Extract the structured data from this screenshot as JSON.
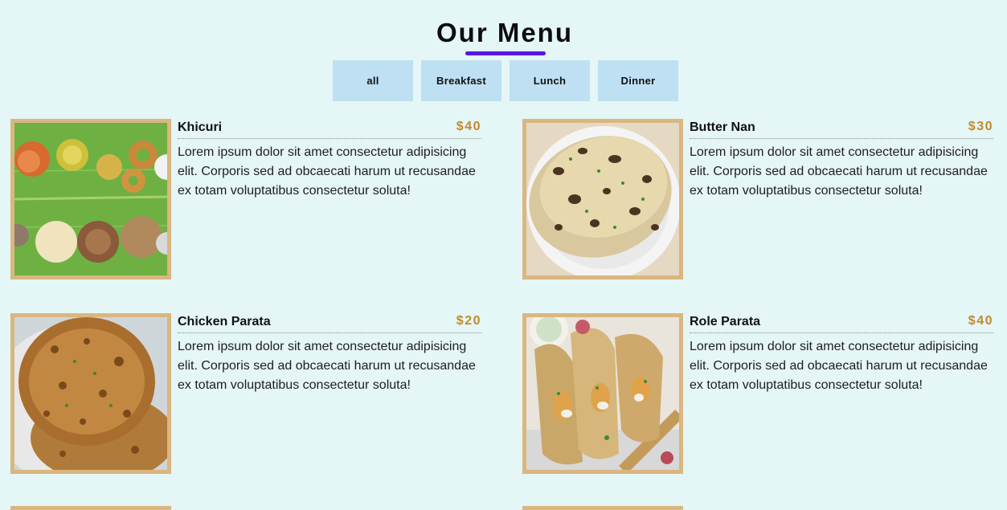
{
  "header": {
    "title": "Our Menu"
  },
  "filters": [
    {
      "label": "all"
    },
    {
      "label": "Breakfast"
    },
    {
      "label": "Lunch"
    },
    {
      "label": "Dinner"
    }
  ],
  "menu_items": [
    {
      "name": "Khicuri",
      "price": "$40",
      "description": "Lorem ipsum dolor sit amet consectetur adipisicing elit. Corporis sed ad obcaecati harum ut recusandae ex totam voluptatibus consectetur soluta!"
    },
    {
      "name": "Butter Nan",
      "price": "$30",
      "description": "Lorem ipsum dolor sit amet consectetur adipisicing elit. Corporis sed ad obcaecati harum ut recusandae ex totam voluptatibus consectetur soluta!"
    },
    {
      "name": "Chicken Parata",
      "price": "$20",
      "description": "Lorem ipsum dolor sit amet consectetur adipisicing elit. Corporis sed ad obcaecati harum ut recusandae ex totam voluptatibus consectetur soluta!"
    },
    {
      "name": "Role Parata",
      "price": "$40",
      "description": "Lorem ipsum dolor sit amet consectetur adipisicing elit. Corporis sed ad obcaecati harum ut recusandae ex totam voluptatibus consectetur soluta!"
    }
  ],
  "colors": {
    "background": "#e4f6f5",
    "accent_underline": "#5a14e8",
    "filter_button": "#bfe0f3",
    "price": "#c28a2c",
    "photo_border": "#dab680"
  }
}
